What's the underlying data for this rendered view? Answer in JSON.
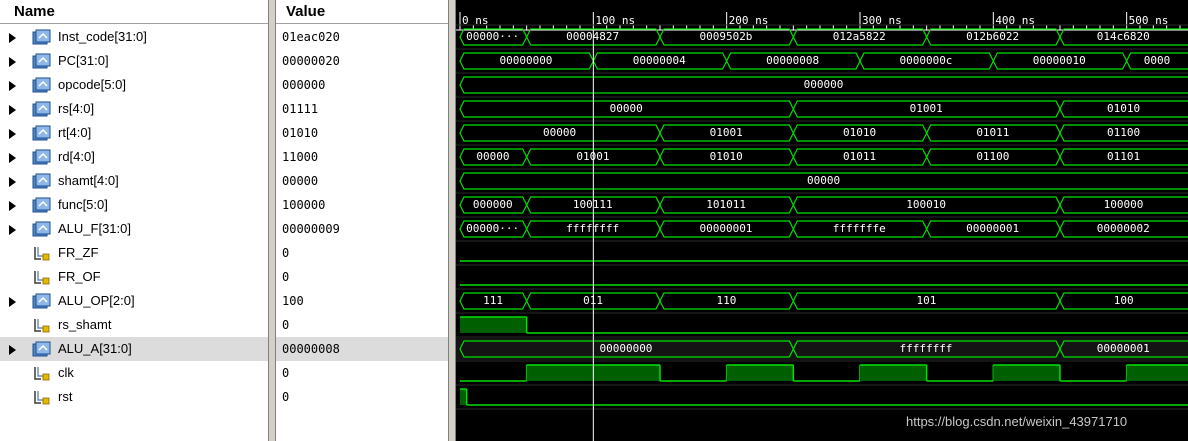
{
  "columns": {
    "name": "Name",
    "value": "Value"
  },
  "signals": [
    {
      "id": "inst-code",
      "name": "Inst_code[31:0]",
      "value": "01eac020",
      "kind": "bus",
      "expandable": true
    },
    {
      "id": "pc",
      "name": "PC[31:0]",
      "value": "00000020",
      "kind": "bus",
      "expandable": true
    },
    {
      "id": "opcode",
      "name": "opcode[5:0]",
      "value": "000000",
      "kind": "bus",
      "expandable": true
    },
    {
      "id": "rs",
      "name": "rs[4:0]",
      "value": "01111",
      "kind": "bus",
      "expandable": true
    },
    {
      "id": "rt",
      "name": "rt[4:0]",
      "value": "01010",
      "kind": "bus",
      "expandable": true
    },
    {
      "id": "rd",
      "name": "rd[4:0]",
      "value": "11000",
      "kind": "bus",
      "expandable": true
    },
    {
      "id": "shamt",
      "name": "shamt[4:0]",
      "value": "00000",
      "kind": "bus",
      "expandable": true
    },
    {
      "id": "func",
      "name": "func[5:0]",
      "value": "100000",
      "kind": "bus",
      "expandable": true
    },
    {
      "id": "alu-f",
      "name": "ALU_F[31:0]",
      "value": "00000009",
      "kind": "bus",
      "expandable": true
    },
    {
      "id": "fr-zf",
      "name": "FR_ZF",
      "value": "0",
      "kind": "bit",
      "expandable": false
    },
    {
      "id": "fr-of",
      "name": "FR_OF",
      "value": "0",
      "kind": "bit",
      "expandable": false
    },
    {
      "id": "alu-op",
      "name": "ALU_OP[2:0]",
      "value": "100",
      "kind": "bus",
      "expandable": true
    },
    {
      "id": "rs-shamt",
      "name": "rs_shamt",
      "value": "0",
      "kind": "bit",
      "expandable": false
    },
    {
      "id": "alu-a",
      "name": "ALU_A[31:0]",
      "value": "00000008",
      "kind": "bus",
      "expandable": true,
      "selected": true
    },
    {
      "id": "clk",
      "name": "clk",
      "value": "0",
      "kind": "bit",
      "expandable": false
    },
    {
      "id": "rst",
      "name": "rst",
      "value": "0",
      "kind": "bit",
      "expandable": false
    }
  ],
  "timeline": {
    "unit": "ns",
    "ticks": [
      {
        "t": 0,
        "label": "0 ns"
      },
      {
        "t": 100,
        "label": "100 ns"
      },
      {
        "t": 200,
        "label": "200 ns"
      },
      {
        "t": 300,
        "label": "300 ns"
      },
      {
        "t": 400,
        "label": "400 ns"
      },
      {
        "t": 500,
        "label": "500 ns"
      }
    ],
    "view_ns": [
      0,
      550
    ]
  },
  "waves": {
    "inst-code": {
      "type": "bus",
      "segments": [
        {
          "from": 0,
          "to": 50,
          "label": "00000···"
        },
        {
          "from": 50,
          "to": 150,
          "label": "00004827"
        },
        {
          "from": 150,
          "to": 250,
          "label": "0009502b"
        },
        {
          "from": 250,
          "to": 350,
          "label": "012a5822"
        },
        {
          "from": 350,
          "to": 450,
          "label": "012b6022"
        },
        {
          "from": 450,
          "to": 550,
          "label": "014c6820"
        }
      ]
    },
    "pc": {
      "type": "bus",
      "segments": [
        {
          "from": 0,
          "to": 100,
          "label": "00000000"
        },
        {
          "from": 100,
          "to": 200,
          "label": "00000004"
        },
        {
          "from": 200,
          "to": 300,
          "label": "00000008"
        },
        {
          "from": 300,
          "to": 400,
          "label": "0000000c"
        },
        {
          "from": 400,
          "to": 500,
          "label": "00000010"
        },
        {
          "from": 500,
          "to": 550,
          "label": "0000"
        }
      ]
    },
    "opcode": {
      "type": "bus",
      "segments": [
        {
          "from": 0,
          "to": 550,
          "label": "000000"
        }
      ]
    },
    "rs": {
      "type": "bus",
      "segments": [
        {
          "from": 0,
          "to": 250,
          "label": "00000"
        },
        {
          "from": 250,
          "to": 450,
          "label": "01001"
        },
        {
          "from": 450,
          "to": 550,
          "label": "01010"
        }
      ]
    },
    "rt": {
      "type": "bus",
      "segments": [
        {
          "from": 0,
          "to": 150,
          "label": "00000"
        },
        {
          "from": 150,
          "to": 250,
          "label": "01001"
        },
        {
          "from": 250,
          "to": 350,
          "label": "01010"
        },
        {
          "from": 350,
          "to": 450,
          "label": "01011"
        },
        {
          "from": 450,
          "to": 550,
          "label": "01100"
        }
      ]
    },
    "rd": {
      "type": "bus",
      "segments": [
        {
          "from": 0,
          "to": 50,
          "label": "00000"
        },
        {
          "from": 50,
          "to": 150,
          "label": "01001"
        },
        {
          "from": 150,
          "to": 250,
          "label": "01010"
        },
        {
          "from": 250,
          "to": 350,
          "label": "01011"
        },
        {
          "from": 350,
          "to": 450,
          "label": "01100"
        },
        {
          "from": 450,
          "to": 550,
          "label": "01101"
        }
      ]
    },
    "shamt": {
      "type": "bus",
      "segments": [
        {
          "from": 0,
          "to": 550,
          "label": "00000"
        }
      ]
    },
    "func": {
      "type": "bus",
      "segments": [
        {
          "from": 0,
          "to": 50,
          "label": "000000"
        },
        {
          "from": 50,
          "to": 150,
          "label": "100111"
        },
        {
          "from": 150,
          "to": 250,
          "label": "101011"
        },
        {
          "from": 250,
          "to": 450,
          "label": "100010"
        },
        {
          "from": 450,
          "to": 550,
          "label": "100000"
        }
      ]
    },
    "alu-f": {
      "type": "bus",
      "segments": [
        {
          "from": 0,
          "to": 50,
          "label": "00000···"
        },
        {
          "from": 50,
          "to": 150,
          "label": "ffffffff"
        },
        {
          "from": 150,
          "to": 250,
          "label": "00000001"
        },
        {
          "from": 250,
          "to": 350,
          "label": "fffffffe"
        },
        {
          "from": 350,
          "to": 450,
          "label": "00000001"
        },
        {
          "from": 450,
          "to": 550,
          "label": "00000002"
        }
      ]
    },
    "fr-zf": {
      "type": "bit",
      "transitions": [
        {
          "t": 0,
          "v": 0
        }
      ]
    },
    "fr-of": {
      "type": "bit",
      "transitions": [
        {
          "t": 0,
          "v": 0
        }
      ]
    },
    "alu-op": {
      "type": "bus",
      "segments": [
        {
          "from": 0,
          "to": 50,
          "label": "111"
        },
        {
          "from": 50,
          "to": 150,
          "label": "011"
        },
        {
          "from": 150,
          "to": 250,
          "label": "110"
        },
        {
          "from": 250,
          "to": 450,
          "label": "101"
        },
        {
          "from": 450,
          "to": 550,
          "label": "100"
        }
      ]
    },
    "rs-shamt": {
      "type": "bit",
      "transitions": [
        {
          "t": 0,
          "v": 1
        },
        {
          "t": 50,
          "v": 0
        }
      ]
    },
    "alu-a": {
      "type": "bus",
      "segments": [
        {
          "from": 0,
          "to": 250,
          "label": "00000000"
        },
        {
          "from": 250,
          "to": 450,
          "label": "ffffffff"
        },
        {
          "from": 450,
          "to": 550,
          "label": "00000001"
        }
      ]
    },
    "clk": {
      "type": "bit",
      "transitions": [
        {
          "t": 0,
          "v": 0
        },
        {
          "t": 50,
          "v": 1
        },
        {
          "t": 150,
          "v": 0
        },
        {
          "t": 200,
          "v": 1
        },
        {
          "t": 250,
          "v": 0
        },
        {
          "t": 300,
          "v": 1
        },
        {
          "t": 350,
          "v": 0
        },
        {
          "t": 400,
          "v": 1
        },
        {
          "t": 450,
          "v": 0
        },
        {
          "t": 500,
          "v": 1
        }
      ]
    },
    "rst": {
      "type": "bit",
      "transitions": [
        {
          "t": 0,
          "v": 1
        },
        {
          "t": 5,
          "v": 0
        }
      ]
    }
  },
  "colors": {
    "wave": "#00e000",
    "wave_fill": "#005f00",
    "bus_text": "#ffffff",
    "background": "#000000",
    "cursor": "#ffffff"
  },
  "watermark": "https://blog.csdn.net/weixin_43971710"
}
